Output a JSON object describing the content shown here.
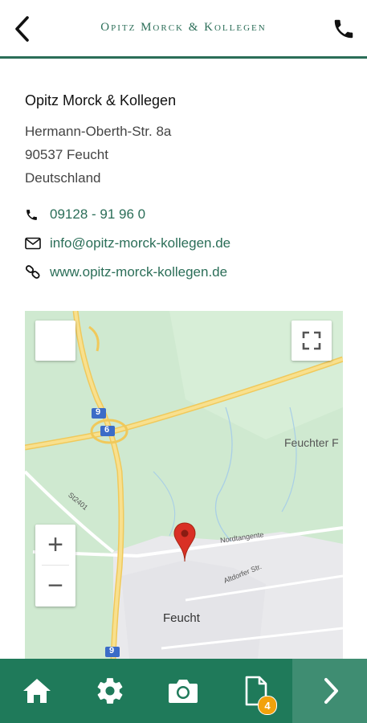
{
  "header": {
    "brand": "Opitz Morck & Kollegen",
    "back_icon": "chevron-left-icon",
    "call_icon": "phone-icon"
  },
  "contact": {
    "company": "Opitz Morck & Kollegen",
    "street": "Hermann-Oberth-Str. 8a",
    "city_line": "90537 Feucht",
    "country": "Deutschland",
    "phone": "09128 - 91 96 0",
    "email": "info@opitz-morck-kollegen.de",
    "website": "www.opitz-morck-kollegen.de"
  },
  "map": {
    "labels": {
      "feuchter": "Feuchter F",
      "feucht": "Feucht",
      "nordtangente": "Nordtangente",
      "altdorfer": "Altdorfer Str.",
      "st2401": "St2401",
      "route9_top": "9",
      "route6": "6",
      "route9_bottom": "9"
    },
    "zoom_in_label": "+",
    "zoom_out_label": "−",
    "marker_icon": "map-pin-icon"
  },
  "bottom_nav": {
    "items": [
      "home-icon",
      "gear-icon",
      "camera-icon",
      "document-icon",
      "chevron-right-icon"
    ],
    "document_badge": "4"
  },
  "colors": {
    "brand_green": "#2b6e58",
    "bar_green": "#1f7a5a",
    "bar_next": "#3f8d72",
    "badge": "#f2a20c",
    "marker": "#d93025"
  }
}
